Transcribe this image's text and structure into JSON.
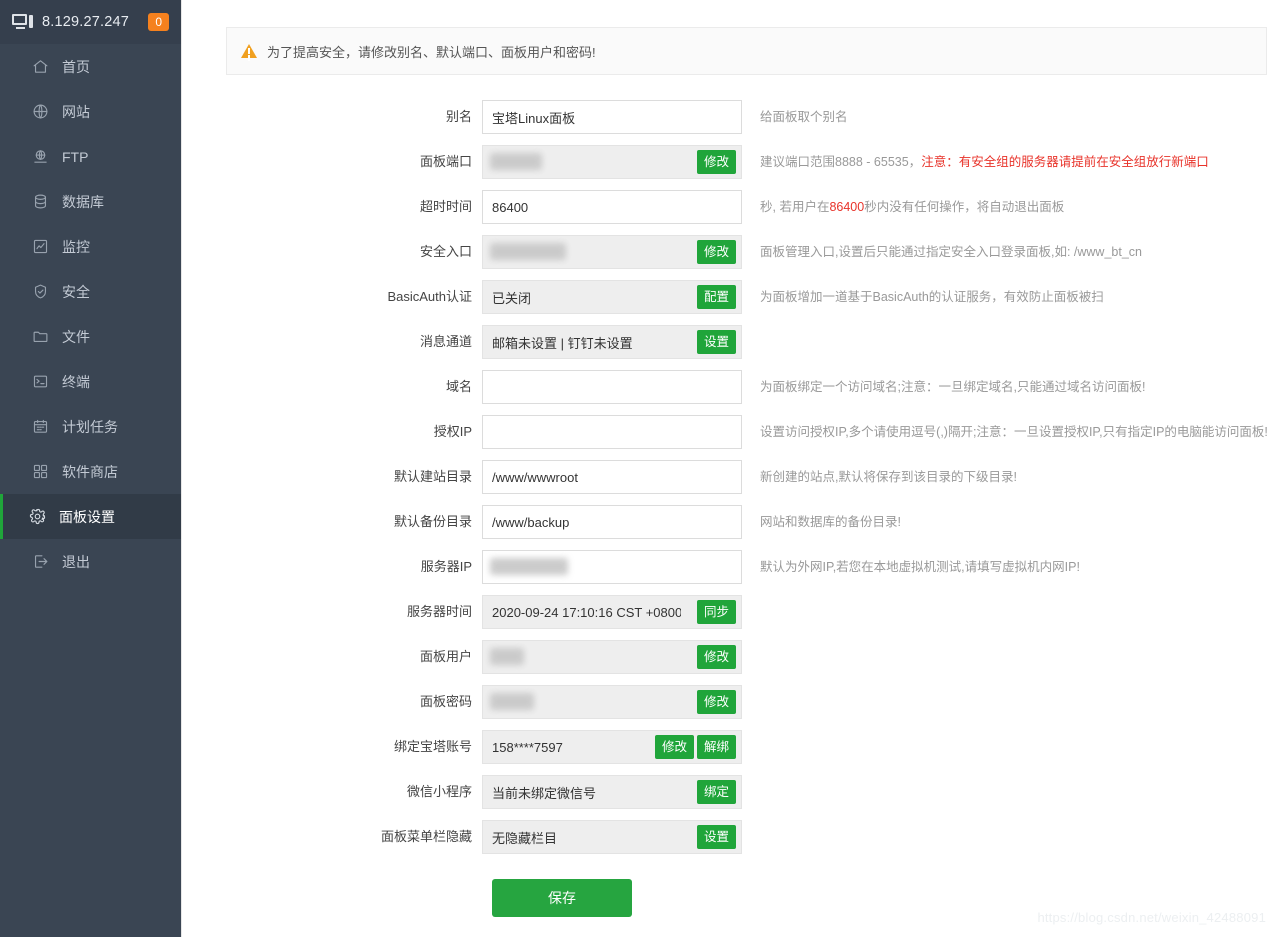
{
  "sidebar": {
    "ip": "8.129.27.247",
    "badge": "0",
    "items": [
      {
        "label": "首页",
        "icon": "home-icon"
      },
      {
        "label": "网站",
        "icon": "globe-icon"
      },
      {
        "label": "FTP",
        "icon": "ftp-icon"
      },
      {
        "label": "数据库",
        "icon": "database-icon"
      },
      {
        "label": "监控",
        "icon": "chart-icon"
      },
      {
        "label": "安全",
        "icon": "shield-icon"
      },
      {
        "label": "文件",
        "icon": "folder-icon"
      },
      {
        "label": "终端",
        "icon": "terminal-icon"
      },
      {
        "label": "计划任务",
        "icon": "calendar-icon"
      },
      {
        "label": "软件商店",
        "icon": "grid-icon"
      },
      {
        "label": "面板设置",
        "icon": "gear-icon"
      },
      {
        "label": "退出",
        "icon": "logout-icon"
      }
    ],
    "active_index": 10
  },
  "alert": {
    "text": "为了提高安全，请修改别名、默认端口、面板用户和密码!"
  },
  "form": {
    "rows": [
      {
        "label": "别名",
        "value": "宝塔Linux面板",
        "readonly": false,
        "blurred": false,
        "buttons": [],
        "hint_plain": "给面板取个别名"
      },
      {
        "label": "面板端口",
        "value": "",
        "readonly": true,
        "blurred": true,
        "blur_width": 52,
        "buttons": [
          "修改"
        ],
        "hint_pre": "建议端口范围8888 - 65535，",
        "hint_red": "注意：有安全组的服务器请提前在安全组放行新端口"
      },
      {
        "label": "超时时间",
        "value": "86400",
        "readonly": false,
        "blurred": false,
        "buttons": [],
        "hint_pre": "秒, 若用户在",
        "hint_red": "86400",
        "hint_post": "秒内没有任何操作，将自动退出面板"
      },
      {
        "label": "安全入口",
        "value": "",
        "readonly": true,
        "blurred": true,
        "blur_width": 76,
        "buttons": [
          "修改"
        ],
        "hint_plain": "面板管理入口,设置后只能通过指定安全入口登录面板,如: /www_bt_cn"
      },
      {
        "label": "BasicAuth认证",
        "value": "已关闭",
        "readonly": true,
        "blurred": false,
        "buttons": [
          "配置"
        ],
        "hint_plain": "为面板增加一道基于BasicAuth的认证服务，有效防止面板被扫"
      },
      {
        "label": "消息通道",
        "value": "邮箱未设置 | 钉钉未设置",
        "readonly": true,
        "blurred": false,
        "buttons": [
          "设置"
        ],
        "hint_plain": ""
      },
      {
        "label": "域名",
        "value": "",
        "readonly": false,
        "blurred": false,
        "buttons": [],
        "hint_plain": "为面板绑定一个访问域名;注意：一旦绑定域名,只能通过域名访问面板!"
      },
      {
        "label": "授权IP",
        "value": "",
        "readonly": false,
        "blurred": false,
        "buttons": [],
        "hint_plain": "设置访问授权IP,多个请使用逗号(,)隔开;注意：一旦设置授权IP,只有指定IP的电脑能访问面板!"
      },
      {
        "label": "默认建站目录",
        "value": "/www/wwwroot",
        "readonly": false,
        "blurred": false,
        "buttons": [],
        "hint_plain": "新创建的站点,默认将保存到该目录的下级目录!"
      },
      {
        "label": "默认备份目录",
        "value": "/www/backup",
        "readonly": false,
        "blurred": false,
        "buttons": [],
        "hint_plain": "网站和数据库的备份目录!"
      },
      {
        "label": "服务器IP",
        "value": "",
        "readonly": false,
        "blurred": true,
        "blur_width": 78,
        "buttons": [],
        "hint_plain": "默认为外网IP,若您在本地虚拟机测试,请填写虚拟机内网IP!"
      },
      {
        "label": "服务器时间",
        "value": "2020-09-24 17:10:16 CST +0800",
        "readonly": true,
        "blurred": false,
        "buttons": [
          "同步"
        ],
        "hint_plain": ""
      },
      {
        "label": "面板用户",
        "value": "",
        "readonly": true,
        "blurred": true,
        "blur_width": 34,
        "buttons": [
          "修改"
        ],
        "hint_plain": ""
      },
      {
        "label": "面板密码",
        "value": "",
        "readonly": true,
        "blurred": true,
        "blur_width": 44,
        "buttons": [
          "修改"
        ],
        "hint_plain": ""
      },
      {
        "label": "绑定宝塔账号",
        "value": "158****7597",
        "readonly": true,
        "blurred": false,
        "buttons": [
          "修改",
          "解绑"
        ],
        "hint_plain": ""
      },
      {
        "label": "微信小程序",
        "value": "当前未绑定微信号",
        "readonly": true,
        "blurred": false,
        "buttons": [
          "绑定"
        ],
        "hint_plain": ""
      },
      {
        "label": "面板菜单栏隐藏",
        "value": "无隐藏栏目",
        "readonly": true,
        "blurred": false,
        "buttons": [
          "设置"
        ],
        "hint_plain": ""
      }
    ],
    "save_label": "保存"
  },
  "watermark": "https://blog.csdn.net/weixin_42488091",
  "colors": {
    "sidebar_bg": "#3a4553",
    "sidebar_header_bg": "#353f4d",
    "accent_green": "#20a53a",
    "badge_orange": "#f5811e",
    "warning_orange": "#f0a020",
    "hint_red": "#e8332a"
  }
}
